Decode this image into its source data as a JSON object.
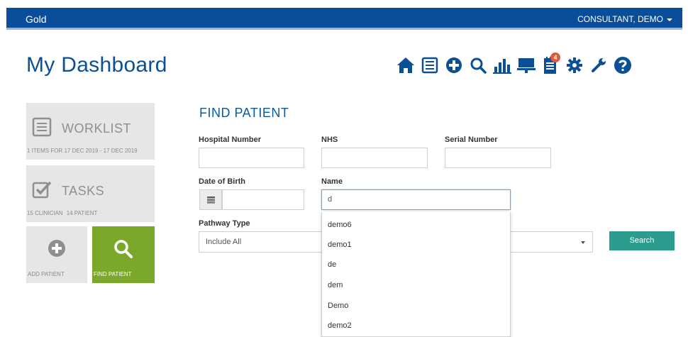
{
  "header": {
    "brand": "Gold",
    "user": "CONSULTANT, DEMO"
  },
  "page_title": "My Dashboard",
  "toolbar": {
    "icons": [
      "home-icon",
      "list-icon",
      "plus-circle-icon",
      "search-icon",
      "bar-chart-icon",
      "presentation-icon",
      "notes-icon",
      "gear-icon",
      "wrench-icon",
      "help-icon"
    ],
    "notes_badge": "4"
  },
  "tiles": {
    "worklist": {
      "title": "WORKLIST",
      "subtitle": "1 ITEMS FOR 17 DEC 2019 - 17 DEC 2019"
    },
    "tasks": {
      "title": "TASKS",
      "clinician": "15 CLINICIAN",
      "patient": "14 PATIENT"
    },
    "add_patient": {
      "label": "ADD PATIENT"
    },
    "find_patient": {
      "label": "FIND PATIENT"
    }
  },
  "find_patient": {
    "title": "FIND PATIENT",
    "hospital_number": {
      "label": "Hospital Number",
      "value": ""
    },
    "nhs": {
      "label": "NHS",
      "value": ""
    },
    "serial_number": {
      "label": "Serial Number",
      "value": ""
    },
    "dob": {
      "label": "Date of Birth",
      "value": ""
    },
    "name": {
      "label": "Name",
      "value": "d"
    },
    "pathway_type": {
      "label": "Pathway Type",
      "selected": "Include All"
    },
    "search_button": "Search",
    "suggestions": [
      "demo6",
      "demo1",
      "de",
      "dem",
      "Demo",
      "demo2"
    ]
  },
  "colors": {
    "header_bg": "#0a4e9a",
    "title": "#0b4f95",
    "tile_bg": "#e6e6e6",
    "find_tile_bg": "#7ba82a",
    "search_button": "#2a9d8f",
    "badge": "#e0593e"
  }
}
